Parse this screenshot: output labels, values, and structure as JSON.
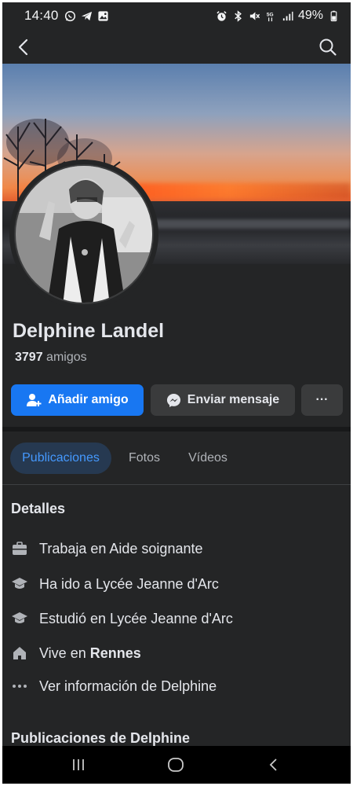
{
  "status_bar": {
    "time": "14:40",
    "battery": "49%",
    "network": "5G"
  },
  "nav": {
    "back_icon": "chevron-left-icon",
    "search_icon": "search-icon"
  },
  "profile": {
    "name": "Delphine Landel",
    "friends_count": "3797",
    "friends_label": "amigos"
  },
  "actions": {
    "add_friend": "Añadir amigo",
    "send_message": "Enviar mensaje",
    "more": "···"
  },
  "tabs": [
    {
      "label": "Publicaciones",
      "active": true
    },
    {
      "label": "Fotos",
      "active": false
    },
    {
      "label": "Vídeos",
      "active": false
    }
  ],
  "details": {
    "title": "Detalles",
    "items": [
      {
        "icon": "briefcase-icon",
        "text": "Trabaja en Aide soignante"
      },
      {
        "icon": "graduation-cap-icon",
        "text": "Ha ido a Lycée Jeanne d'Arc"
      },
      {
        "icon": "graduation-cap-icon",
        "text": "Estudió en Lycée Jeanne d'Arc"
      },
      {
        "icon": "home-icon",
        "text": "Vive en",
        "bold": "Rennes"
      },
      {
        "icon": "more-dots-icon",
        "text": "Ver información de Delphine"
      }
    ]
  },
  "posts_title": "Publicaciones de Delphine",
  "colors": {
    "background": "#242526",
    "primary": "#1877f2",
    "tab_active_bg": "#263951",
    "tab_active_text": "#4599ff"
  }
}
